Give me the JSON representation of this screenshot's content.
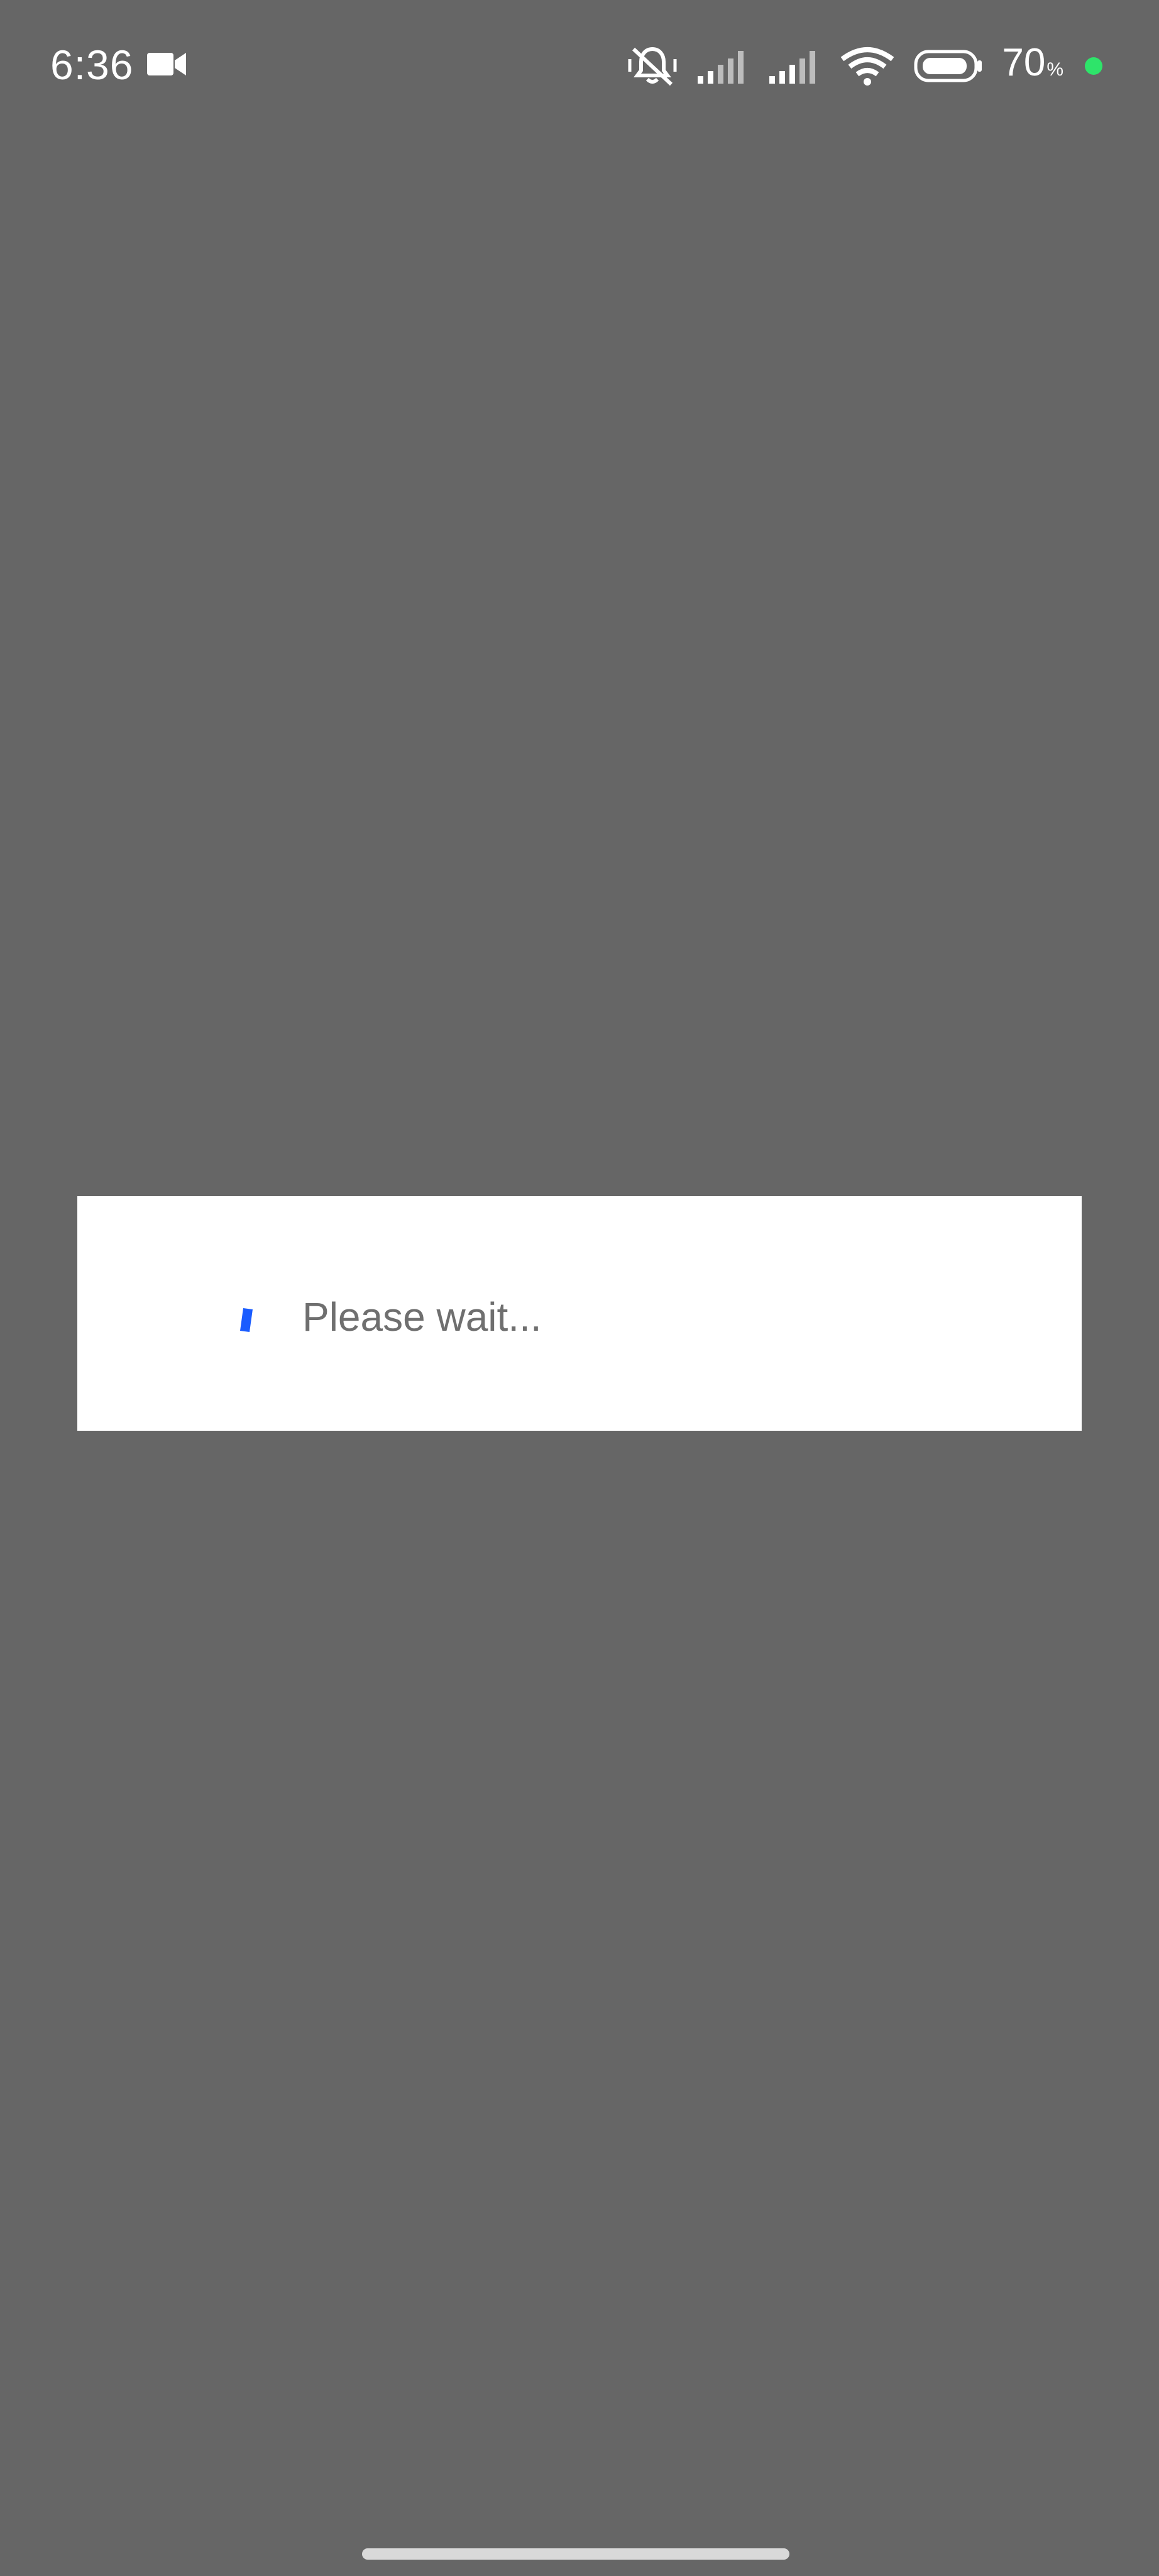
{
  "status_bar": {
    "time": "6:36",
    "battery_level": "70",
    "battery_unit": "%",
    "icons": {
      "recording": "video-camera-icon",
      "silent": "vibrate-off-icon",
      "signal_1": "signal-bars-icon",
      "signal_2": "signal-bars-icon",
      "wifi": "wifi-icon",
      "battery": "battery-icon",
      "charging": "charging-dot-icon"
    },
    "colors": {
      "charging_dot": "#2ee46a"
    }
  },
  "dialog": {
    "message": "Please wait...",
    "spinner_color": "#1a5cff"
  },
  "background_color": "#666666"
}
